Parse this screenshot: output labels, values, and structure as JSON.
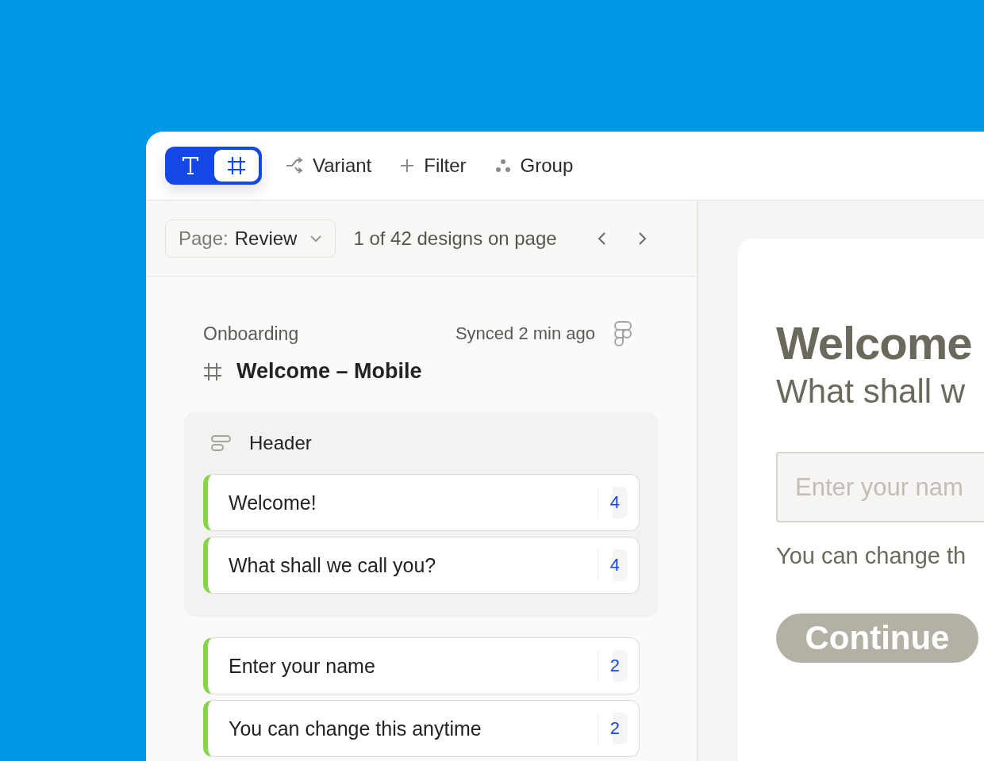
{
  "toolbar": {
    "mode_toggle": [
      {
        "kind": "text",
        "selected": false
      },
      {
        "kind": "frame",
        "selected": true
      }
    ],
    "actions": [
      {
        "kind": "variant",
        "label": "Variant"
      },
      {
        "kind": "filter",
        "label": "Filter"
      },
      {
        "kind": "group",
        "label": "Group"
      }
    ]
  },
  "page_bar": {
    "page_select": {
      "label": "Page:",
      "value": "Review"
    },
    "count": "1 of 42 designs on page"
  },
  "frame": {
    "section": "Onboarding",
    "sync_status": "Synced 2 min ago",
    "title": "Welcome – Mobile",
    "groups": [
      {
        "name": "Header",
        "items": [
          {
            "text": "Welcome!",
            "count": "4"
          },
          {
            "text": "What shall we call you?",
            "count": "4"
          }
        ]
      }
    ],
    "items": [
      {
        "text": "Enter your name",
        "count": "2"
      },
      {
        "text": "You can change this anytime",
        "count": "2"
      }
    ]
  },
  "preview": {
    "title": "Welcome",
    "subtitle": "What shall w",
    "input": {
      "placeholder": "Enter your nam"
    },
    "hint": "You can change th",
    "button": {
      "label": "Continue",
      "disabled": true
    }
  }
}
